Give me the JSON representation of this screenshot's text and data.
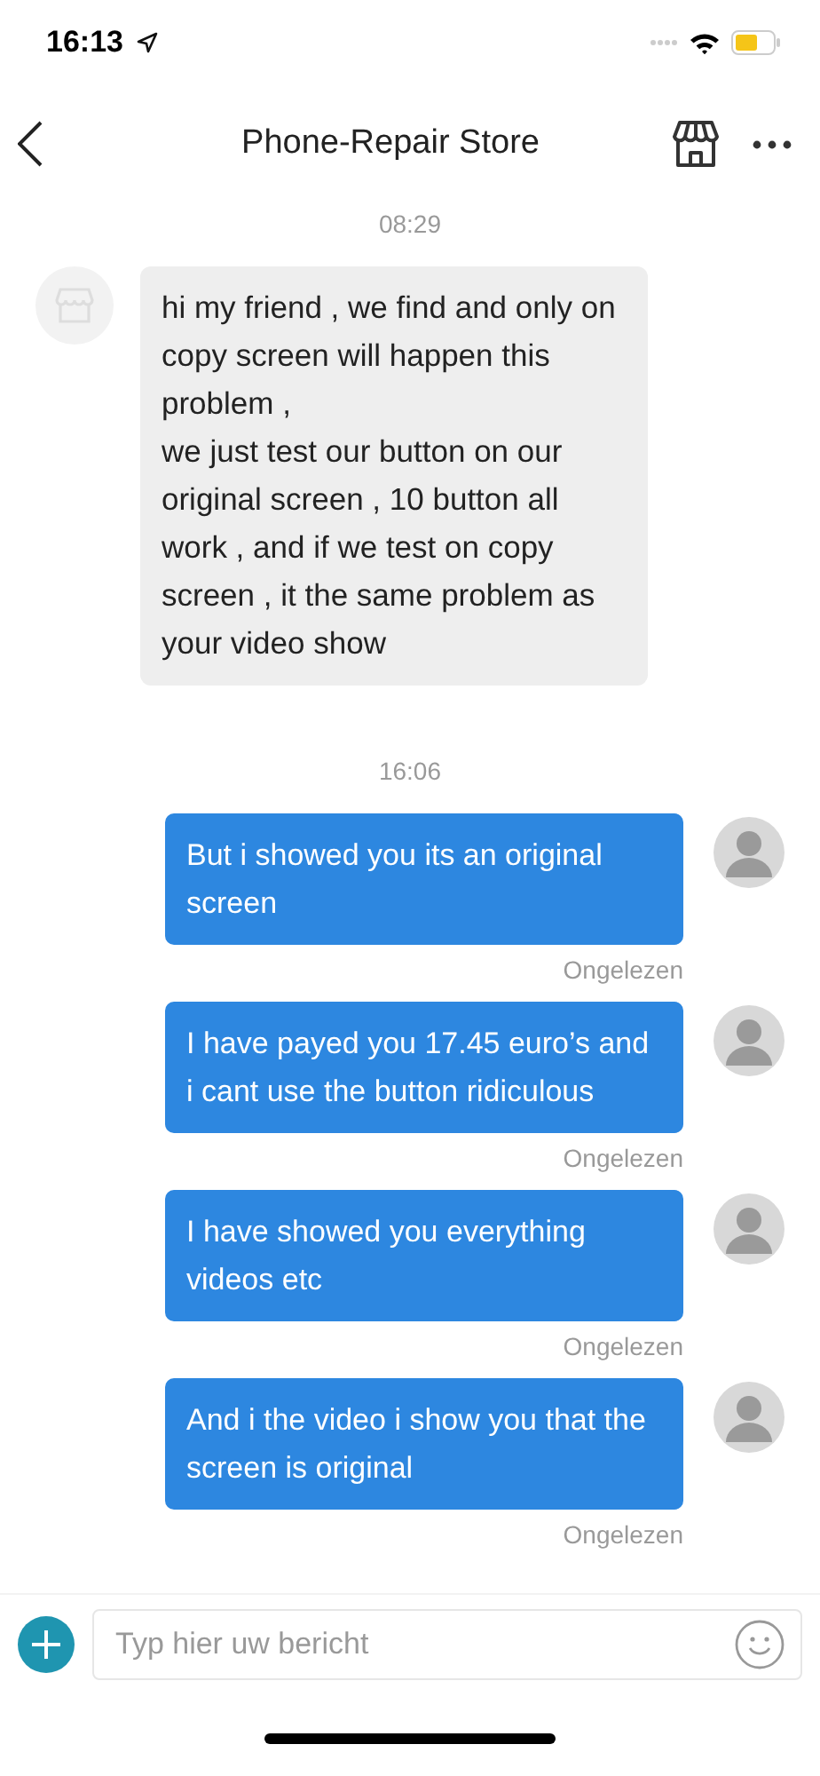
{
  "status_bar": {
    "time": "16:13"
  },
  "header": {
    "title": "Phone-Repair Store"
  },
  "messages": [
    {
      "kind": "time",
      "text": "08:29"
    },
    {
      "kind": "incoming",
      "text": "hi my friend , we find and only on copy screen will happen this problem ,\nwe just test our button on our original screen , 10 button all work , and if we test on copy screen , it the same problem as your video show"
    },
    {
      "kind": "time",
      "text": "16:06"
    },
    {
      "kind": "outgoing",
      "text": "But i showed you its an original screen",
      "status": "Ongelezen"
    },
    {
      "kind": "outgoing",
      "text": "I have payed you 17.45 euro’s and i cant use the button ridiculous",
      "status": "Ongelezen"
    },
    {
      "kind": "outgoing",
      "text": "I have showed you everything videos etc",
      "status": "Ongelezen"
    },
    {
      "kind": "outgoing",
      "text": "And i the video i show you that the screen is original",
      "status": "Ongelezen"
    }
  ],
  "composer": {
    "placeholder": "Typ hier uw bericht"
  }
}
